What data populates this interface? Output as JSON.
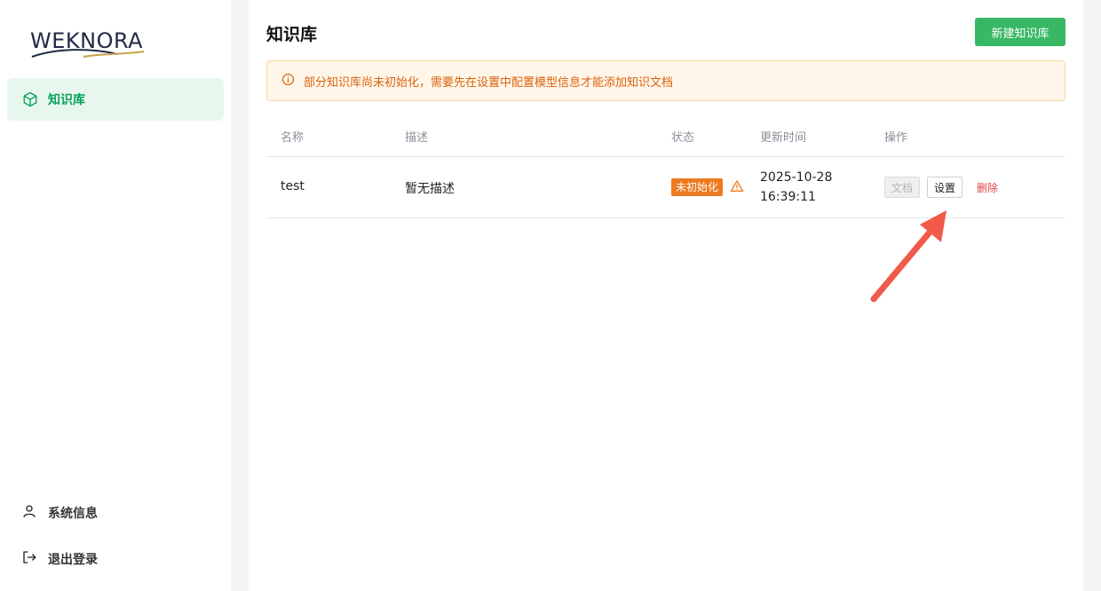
{
  "brand": {
    "logo_text": "WEKNORA"
  },
  "sidebar": {
    "items": [
      {
        "label": "知识库",
        "icon": "cube-icon",
        "active": true
      }
    ],
    "bottom_items": [
      {
        "label": "系统信息",
        "icon": "user-icon"
      },
      {
        "label": "退出登录",
        "icon": "logout-icon"
      }
    ]
  },
  "main": {
    "title": "知识库",
    "create_button": "新建知识库",
    "alert": "部分知识库尚未初始化，需要先在设置中配置模型信息才能添加知识文档",
    "table": {
      "columns": [
        "名称",
        "描述",
        "状态",
        "更新时间",
        "操作"
      ],
      "rows": [
        {
          "name": "test",
          "description": "暂无描述",
          "status": "未初始化",
          "updated_date": "2025-10-28",
          "updated_time": "16:39:11",
          "actions": {
            "docs": "文档",
            "settings": "设置",
            "delete": "删除"
          }
        }
      ]
    }
  },
  "colors": {
    "accent": "#38b865",
    "active_nav_bg": "#e8f7ee",
    "warning": "#ee7a1f",
    "danger": "#e2434a",
    "annotation_arrow": "#f05a4a"
  }
}
